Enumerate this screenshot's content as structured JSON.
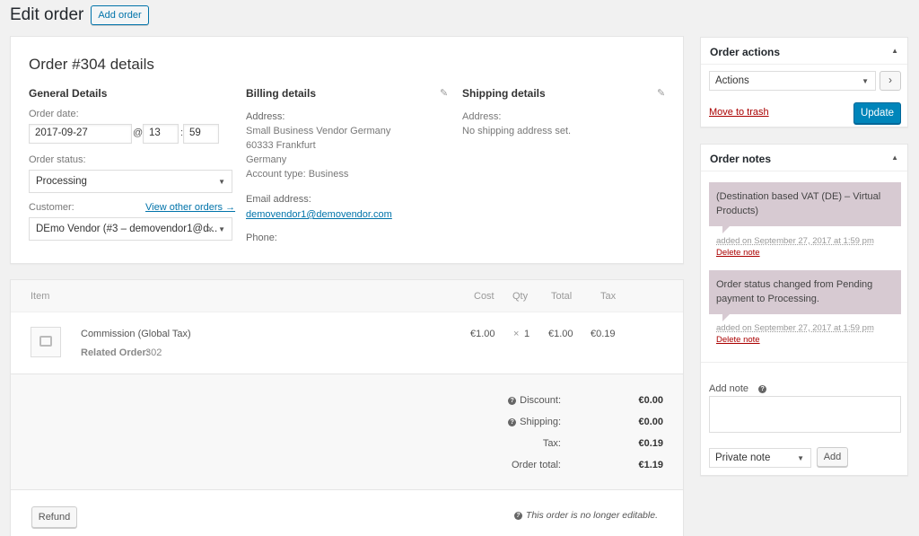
{
  "header": {
    "title": "Edit order",
    "add_order": "Add order"
  },
  "order": {
    "title": "Order #304 details",
    "general": {
      "heading": "General Details",
      "date_label": "Order date:",
      "date": "2017-09-27",
      "at": "@",
      "hour": "13",
      "colon": ":",
      "minute": "59",
      "status_label": "Order status:",
      "status": "Processing",
      "customer_label": "Customer:",
      "view_other": "View other orders →",
      "customer": "DEmo Vendor (#3 – demovendor1@d...",
      "clear": "×"
    },
    "billing": {
      "heading": "Billing details",
      "address_label": "Address:",
      "address_lines": [
        "Small Business Vendor Germany",
        "60333 Frankfurt",
        "Germany",
        "Account type: Business"
      ],
      "email_label": "Email address:",
      "email": "demovendor1@demovendor.com",
      "phone_label": "Phone:"
    },
    "shipping": {
      "heading": "Shipping details",
      "address_label": "Address:",
      "address": "No shipping address set."
    }
  },
  "items": {
    "headers": {
      "item": "Item",
      "cost": "Cost",
      "qty": "Qty",
      "total": "Total",
      "tax": "Tax"
    },
    "rows": [
      {
        "name": "Commission (Global Tax)",
        "meta_label": "Related Order:",
        "meta_value": "302",
        "cost": "€1.00",
        "qty_x": "×",
        "qty": "1",
        "total": "€1.00",
        "tax": "€0.19"
      }
    ],
    "totals": {
      "discount_label": "Discount:",
      "discount": "€0.00",
      "shipping_label": "Shipping:",
      "shipping": "€0.00",
      "tax_label": "Tax:",
      "tax": "€0.19",
      "order_total_label": "Order total:",
      "order_total": "€1.19"
    },
    "refund": "Refund",
    "not_editable": "This order is no longer editable.",
    "help_glyph": "?"
  },
  "actions": {
    "title": "Order actions",
    "select": "Actions",
    "go": "›",
    "trash": "Move to trash",
    "update": "Update"
  },
  "notes": {
    "title": "Order notes",
    "list": [
      {
        "text": "(Destination based VAT (DE) – Virtual Products)",
        "added": "added on September 27, 2017 at 1:59 pm",
        "delete": "Delete note"
      },
      {
        "text": "Order status changed from Pending payment to Processing.",
        "added": "added on September 27, 2017 at 1:59 pm",
        "delete": "Delete note"
      }
    ],
    "add_note_label": "Add note",
    "note_type": "Private note",
    "add": "Add"
  },
  "colors": {
    "primary": "#0085ba",
    "link": "#0073aa",
    "danger": "#a00",
    "note_bg": "#d7cad2"
  }
}
